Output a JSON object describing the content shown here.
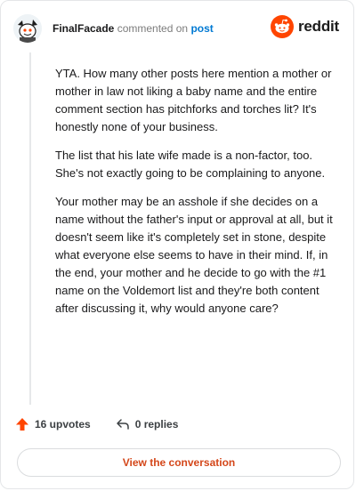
{
  "header": {
    "username": "FinalFacade",
    "verb": "commented on",
    "post_link": "post",
    "brand_text": "reddit",
    "brand_color": "#ff4500",
    "avatar_icon": "snoo-avatar-icon"
  },
  "comment": {
    "paragraphs": [
      "YTA. How many other posts here mention a mother or mother in law not liking a baby name and the entire comment section has pitchforks and torches lit? It's honestly none of your business.",
      "The list that his late wife made is a non-factor, too. She's not exactly going to be complaining to anyone.",
      "Your mother may be an asshole if she decides on a name without the father's input or approval at all, but it doesn't seem like it's completely set in stone, despite what everyone else seems to have in their mind. If, in the end, your mother and he decide to go with the #1 name on the Voldemort list and they're both content after discussing it, why would anyone care?"
    ]
  },
  "actions": {
    "upvotes": "16 upvotes",
    "replies": "0 replies",
    "upvote_icon": "upvote-arrow-icon",
    "reply_icon": "reply-icon",
    "upvote_color": "#ff4500"
  },
  "footer": {
    "view_label": "View the conversation",
    "link_color": "#d4471a"
  }
}
